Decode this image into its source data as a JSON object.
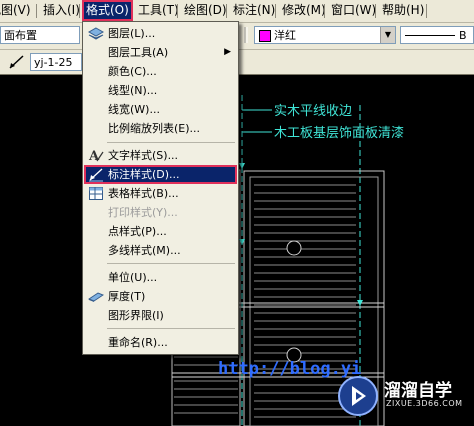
{
  "menubar": {
    "items": [
      {
        "label": "视图(V)"
      },
      {
        "label": "插入(I)"
      },
      {
        "label": "格式(O)"
      },
      {
        "label": "工具(T)"
      },
      {
        "label": "绘图(D)"
      },
      {
        "label": "标注(N)"
      },
      {
        "label": "修改(M)"
      },
      {
        "label": "窗口(W)"
      },
      {
        "label": "帮助(H)"
      }
    ],
    "active_index": 2
  },
  "toolbar": {
    "layout_combo": "面布置",
    "color_combo": "洋红",
    "linetype_combo": "B",
    "dimstyle_combo": "yj-1-25"
  },
  "format_menu": {
    "items": [
      {
        "label": "图层(L)...",
        "icon": "layers-icon"
      },
      {
        "label": "图层工具(A)",
        "icon": "",
        "submenu": true
      },
      {
        "label": "颜色(C)...",
        "icon": ""
      },
      {
        "label": "线型(N)...",
        "icon": ""
      },
      {
        "label": "线宽(W)...",
        "icon": ""
      },
      {
        "label": "比例缩放列表(E)...",
        "icon": ""
      },
      {
        "label": "文字样式(S)...",
        "icon": "text-style-icon"
      },
      {
        "label": "标注样式(D)...",
        "icon": "dimension-style-icon",
        "highlighted": true
      },
      {
        "label": "表格样式(B)...",
        "icon": "table-style-icon"
      },
      {
        "label": "打印样式(Y)...",
        "icon": "",
        "disabled": true
      },
      {
        "label": "点样式(P)...",
        "icon": ""
      },
      {
        "label": "多线样式(M)...",
        "icon": ""
      },
      {
        "label": "单位(U)...",
        "icon": ""
      },
      {
        "label": "厚度(T)",
        "icon": "thickness-icon"
      },
      {
        "label": "图形界限(I)",
        "icon": ""
      },
      {
        "label": "重命名(R)...",
        "icon": ""
      }
    ]
  },
  "drawing": {
    "annotation_1": "实木平线收边",
    "annotation_2": "木工板基层饰面板清漆",
    "watermark_url": "http://blog.yi",
    "brand_name": "溜溜自学",
    "brand_sub": "ZIXUE.3D66.COM"
  },
  "colors": {
    "menu_highlight": "#0a246a",
    "highlight_border": "#e0305a",
    "cad_cyan": "#3fe4d6",
    "magenta_swatch": "#ff00ff"
  }
}
